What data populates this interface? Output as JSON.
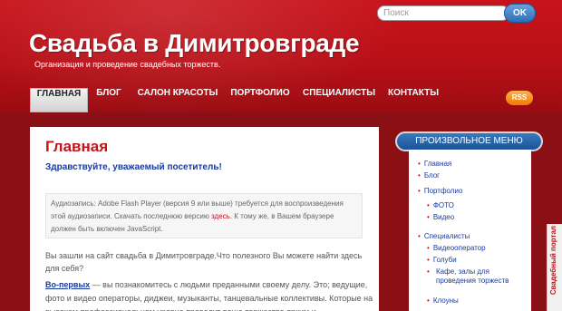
{
  "search": {
    "placeholder": "Поиск",
    "button": "OK"
  },
  "site": {
    "title": "Свадьба в Димитровграде",
    "tagline": "Организация и проведение свадебных торжеств."
  },
  "nav": {
    "items": [
      "ГЛАВНАЯ",
      "БЛОГ",
      "САЛОН КРАСОТЫ",
      "ПОРТФОЛИО",
      "СПЕЦИАЛИСТЫ",
      "КОНТАКТЫ"
    ],
    "rss": "RSS"
  },
  "content": {
    "heading": "Главная",
    "greeting": "Здравствуйте, уважаемый посетитель!",
    "audio_text_before": "Аудиозапись: Adobe Flash Player (версия 9 или выше) требуется для воспроизведения этой аудиозаписи. Скачать последнюю версию ",
    "audio_link": "здесь",
    "audio_text_after": ". К тому же, в Вашем браузере должен быть включен JavaScript.",
    "para1": "Вы зашли на сайт свадьба в Димитровграде.Что полезного Вы можете найти здесь для себя?",
    "para2_lead": "Во-первых",
    "para2_rest": " — вы познакомитесь с людьми преданными своему делу. Это; ведущие, фото и видео операторы, диджеи, музыканты, танцевальные коллективы. Которые на высоком профессиональном уровне проведут ваше торжество ярким и"
  },
  "sidebar": {
    "title": "ПРОИЗВОЛЬНОЕ МЕНЮ",
    "items": [
      "Главная",
      "Блог",
      "Портфолио",
      "ФОТО",
      "Видео",
      "Специалисты",
      "Видеооператор",
      "Голуби",
      "Кафе, залы для проведения торжеств",
      "Клоуны"
    ]
  },
  "badge": {
    "text": "Свадебный портал"
  },
  "colors": {
    "brand_red": "#c0141c",
    "link_blue": "#1a3aa0",
    "accent_blue": "#2c6fb8"
  }
}
